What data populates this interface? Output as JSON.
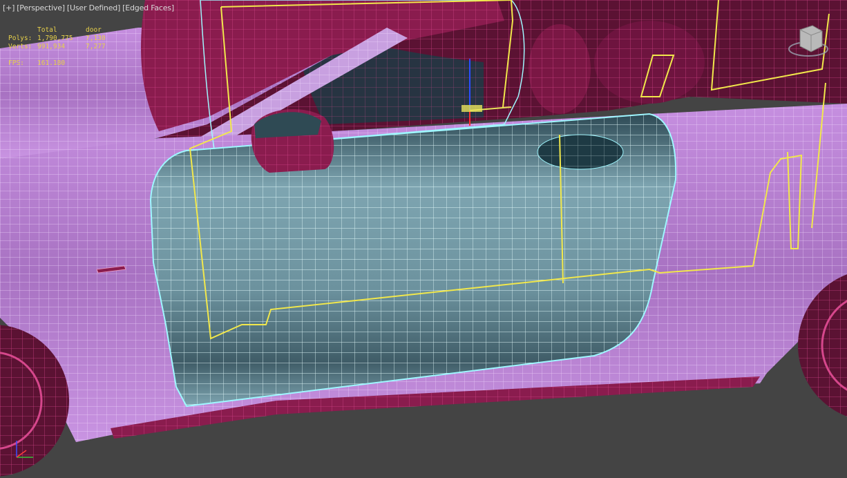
{
  "viewport": {
    "labels": [
      "[+]",
      "[Perspective]",
      "[User Defined]",
      "[Edged Faces]"
    ]
  },
  "stats": {
    "header": {
      "total": "Total",
      "object": "door"
    },
    "rows": [
      {
        "label": "Polys:",
        "total": "1,790,775",
        "object": "7,130"
      },
      {
        "label": "Verts:",
        "total": "991,934",
        "object": "7,277"
      }
    ],
    "fps_label": "FPS:",
    "fps_value": "161.180"
  },
  "colors": {
    "background": "#444444",
    "car_body_wire": "#e6b8f5",
    "interior_wire": "#8a1c4e",
    "selected_door": "#7fb1bf",
    "selection_outline": "#9ff7ff",
    "hidden_lines": "#f2e84b"
  },
  "icons": {
    "viewcube": "viewcube-icon",
    "gizmo": "transform-gizmo-icon",
    "axis": "axis-tripod-icon"
  }
}
